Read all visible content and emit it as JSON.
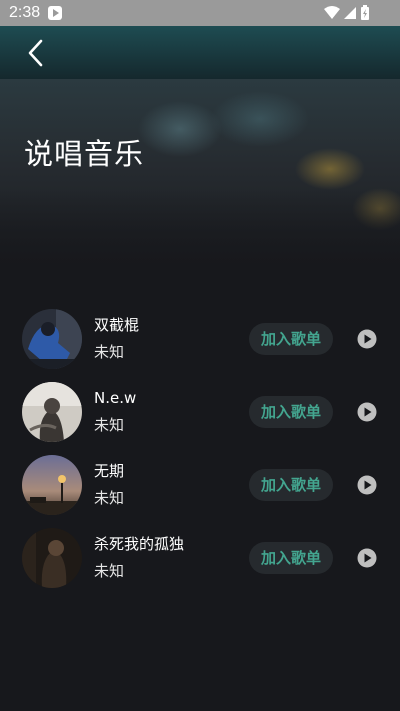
{
  "status_bar": {
    "time": "2:38",
    "icons": [
      "media-play-notification-icon",
      "wifi-icon",
      "cell-signal-icon",
      "battery-charging-icon"
    ]
  },
  "toolbar": {
    "back_icon": "chevron-left-icon"
  },
  "header": {
    "title": "说唱音乐"
  },
  "colors": {
    "background": "#17181c",
    "accent": "#43a58f",
    "button_bg": "#262a2e",
    "toolbar_top": "#1e4c52"
  },
  "songs": [
    {
      "title": "双截棍",
      "artist": "未知",
      "add_label": "加入歌单",
      "play_icon": "play-circle-icon"
    },
    {
      "title": "N.e.w",
      "artist": "未知",
      "add_label": "加入歌单",
      "play_icon": "play-circle-icon"
    },
    {
      "title": "无期",
      "artist": "未知",
      "add_label": "加入歌单",
      "play_icon": "play-circle-icon"
    },
    {
      "title": "杀死我的孤独",
      "artist": "未知",
      "add_label": "加入歌单",
      "play_icon": "play-circle-icon"
    }
  ]
}
